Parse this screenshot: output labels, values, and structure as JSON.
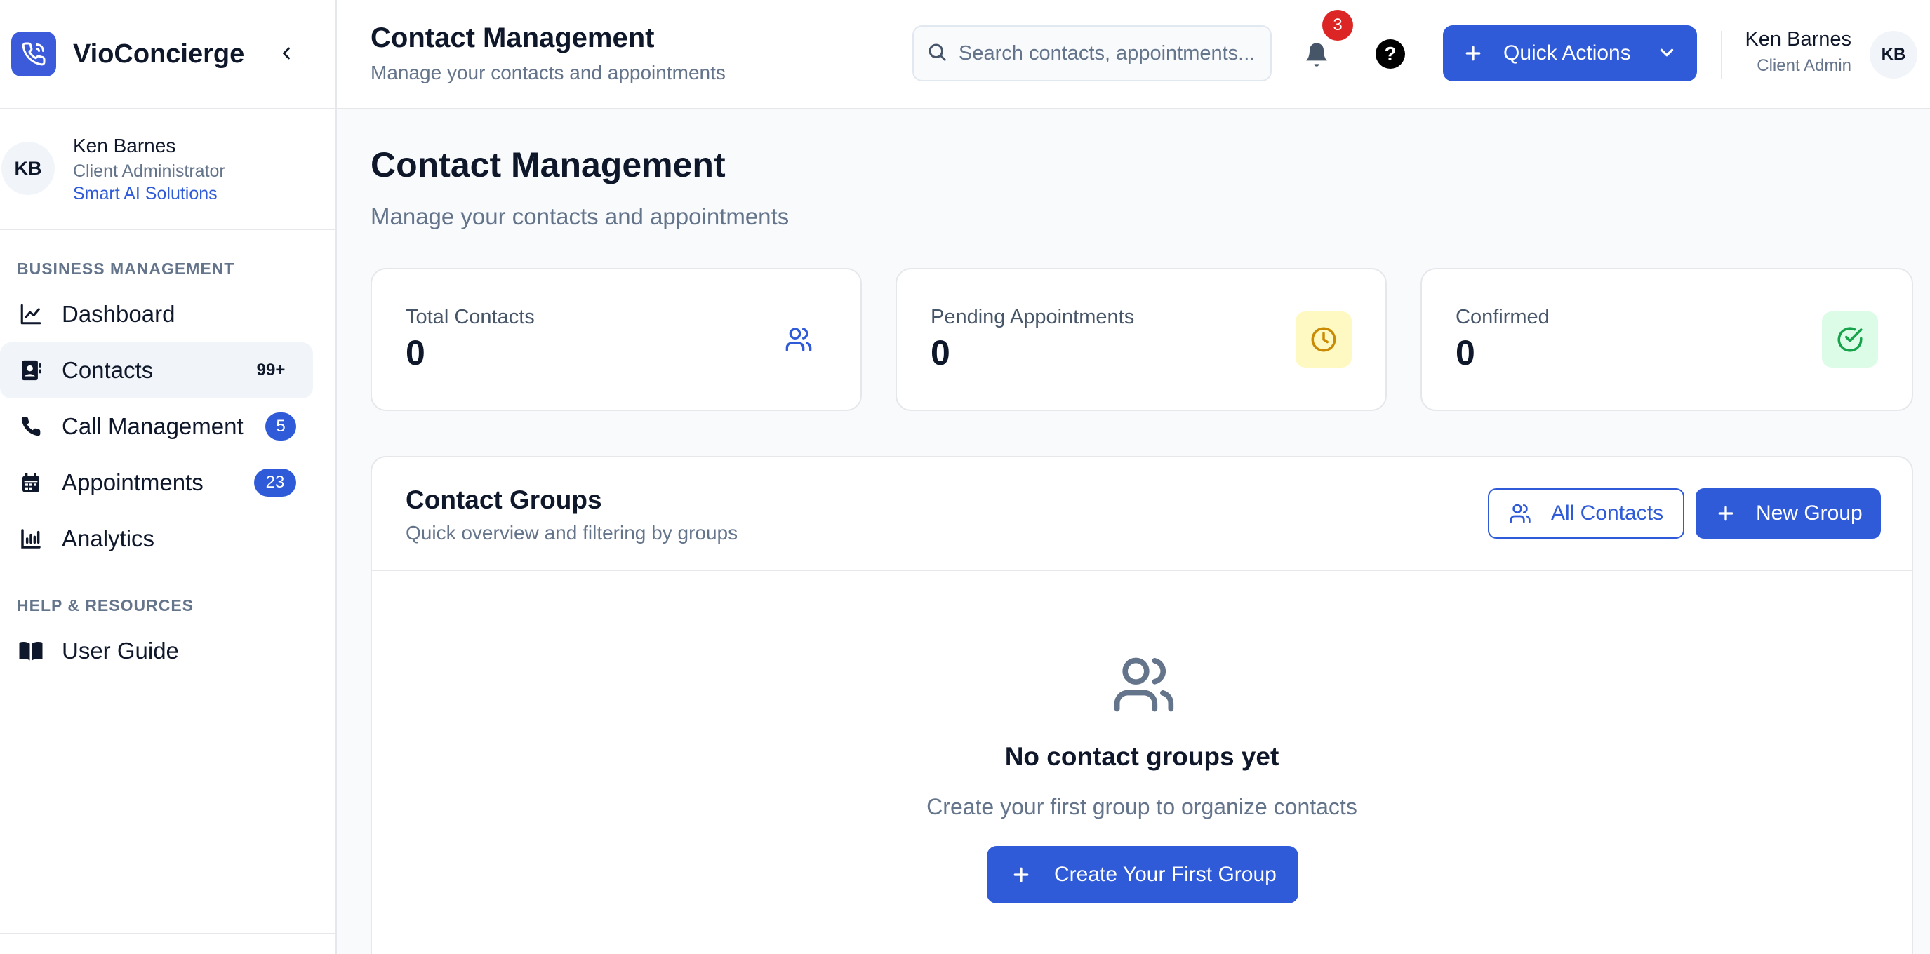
{
  "sidebar": {
    "brand": "VioConcierge",
    "profile": {
      "initials": "KB",
      "name": "Ken Barnes",
      "role": "Client Administrator",
      "org": "Smart AI Solutions"
    },
    "sections": [
      {
        "label": "BUSINESS MANAGEMENT",
        "items": [
          {
            "label": "Dashboard",
            "icon": "chart-line-icon",
            "badge": ""
          },
          {
            "label": "Contacts",
            "icon": "contact-book-icon",
            "badge": "99+",
            "active": true
          },
          {
            "label": "Call Management",
            "icon": "phone-icon",
            "badge": "5"
          },
          {
            "label": "Appointments",
            "icon": "calendar-icon",
            "badge": "23"
          },
          {
            "label": "Analytics",
            "icon": "bar-chart-icon",
            "badge": ""
          }
        ]
      },
      {
        "label": "HELP & RESOURCES",
        "items": [
          {
            "label": "User Guide",
            "icon": "book-icon",
            "badge": ""
          }
        ]
      }
    ]
  },
  "header": {
    "title": "Contact Management",
    "subtitle": "Manage your contacts and appointments",
    "search_placeholder": "Search contacts, appointments...",
    "notification_count": "3",
    "help_glyph": "?",
    "quick_actions_label": "Quick Actions",
    "user": {
      "name": "Ken Barnes",
      "role": "Client Admin",
      "initials": "KB"
    }
  },
  "main": {
    "title": "Contact Management",
    "subtitle": "Manage your contacts and appointments",
    "stats": [
      {
        "label": "Total Contacts",
        "value": "0",
        "icon": "users-icon",
        "color": "#2f5bd9"
      },
      {
        "label": "Pending Appointments",
        "value": "0",
        "icon": "clock-icon",
        "color": "#ca8a04"
      },
      {
        "label": "Confirmed",
        "value": "0",
        "icon": "check-circle-icon",
        "color": "#16a34a"
      }
    ],
    "groups": {
      "title": "Contact Groups",
      "subtitle": "Quick overview and filtering by groups",
      "all_contacts_label": "All Contacts",
      "new_group_label": "New Group",
      "empty_title": "No contact groups yet",
      "empty_subtitle": "Create your first group to organize contacts",
      "empty_button_label": "Create Your First Group"
    }
  },
  "colors": {
    "accent": "#2f5bd9",
    "danger": "#dc2626"
  }
}
